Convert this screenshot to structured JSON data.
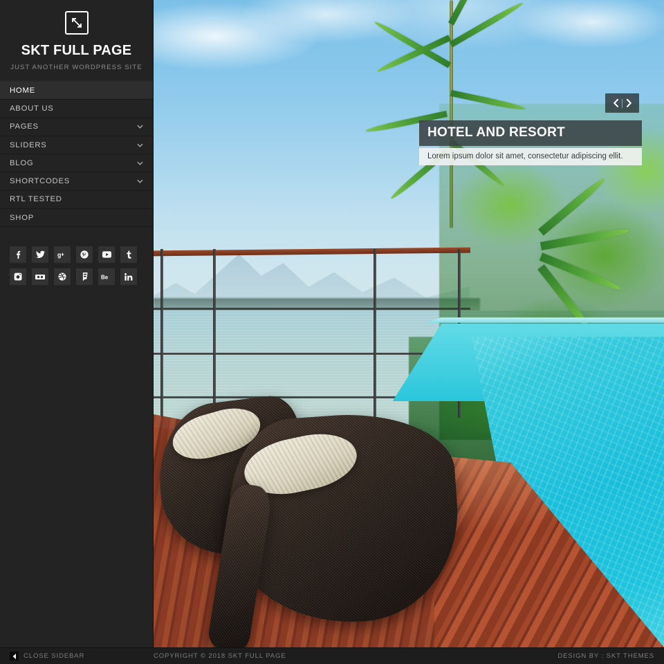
{
  "sidebar": {
    "logo_icon": "expand-arrows-icon",
    "site_title": "SKT FULL PAGE",
    "tagline": "JUST ANOTHER WORDPRESS SITE",
    "menu": [
      {
        "label": "HOME",
        "active": true,
        "has_submenu": false
      },
      {
        "label": "ABOUT US",
        "active": false,
        "has_submenu": false
      },
      {
        "label": "PAGES",
        "active": false,
        "has_submenu": true
      },
      {
        "label": "SLIDERS",
        "active": false,
        "has_submenu": true
      },
      {
        "label": "BLOG",
        "active": false,
        "has_submenu": true
      },
      {
        "label": "SHORTCODES",
        "active": false,
        "has_submenu": true
      },
      {
        "label": "RTL TESTED",
        "active": false,
        "has_submenu": false
      },
      {
        "label": "SHOP",
        "active": false,
        "has_submenu": false
      }
    ],
    "social": [
      [
        {
          "name": "facebook-icon",
          "glyph": "f"
        },
        {
          "name": "twitter-icon",
          "glyph": "t"
        },
        {
          "name": "googleplus-icon",
          "glyph": "g+"
        },
        {
          "name": "pinterest-icon",
          "glyph": "p"
        },
        {
          "name": "youtube-icon",
          "glyph": "yt"
        },
        {
          "name": "tumblr-icon",
          "glyph": "t"
        }
      ],
      [
        {
          "name": "instagram-icon",
          "glyph": "ig"
        },
        {
          "name": "flickr-icon",
          "glyph": "fl"
        },
        {
          "name": "dribbble-icon",
          "glyph": "dr"
        },
        {
          "name": "foursquare-icon",
          "glyph": "4s"
        },
        {
          "name": "behance-icon",
          "glyph": "Be"
        },
        {
          "name": "linkedin-icon",
          "glyph": "in"
        }
      ]
    ]
  },
  "slider": {
    "caption_title": "HOTEL AND RESORT",
    "caption_subtitle": "Lorem ipsum dolor sit amet, consectetur adipiscing ellit.",
    "prev_icon": "chevron-left-icon",
    "next_icon": "chevron-right-icon",
    "image_description": "Tropical resort terrace with wicker lounge chairs, wooden deck and infinity pool overlooking a lake"
  },
  "footer": {
    "close_sidebar_label": "CLOSE SIDEBAR",
    "close_sidebar_icon": "caret-left-icon",
    "copyright": "COPYRIGHT © 2018 SKT FULL PAGE",
    "design_by": "DESIGN BY : SKT THEMES"
  },
  "colors": {
    "sidebar_bg": "#232323",
    "sidebar_active_bg": "#2e2e2e",
    "footer_bg": "#1d1d1d",
    "muted_text": "#7d7d7d",
    "caption_bar": "#3a4246",
    "caption_sub_bar": "#f0f2f2",
    "pool_turquoise": "#1ec4dd",
    "deck_wood": "#a3472a"
  }
}
